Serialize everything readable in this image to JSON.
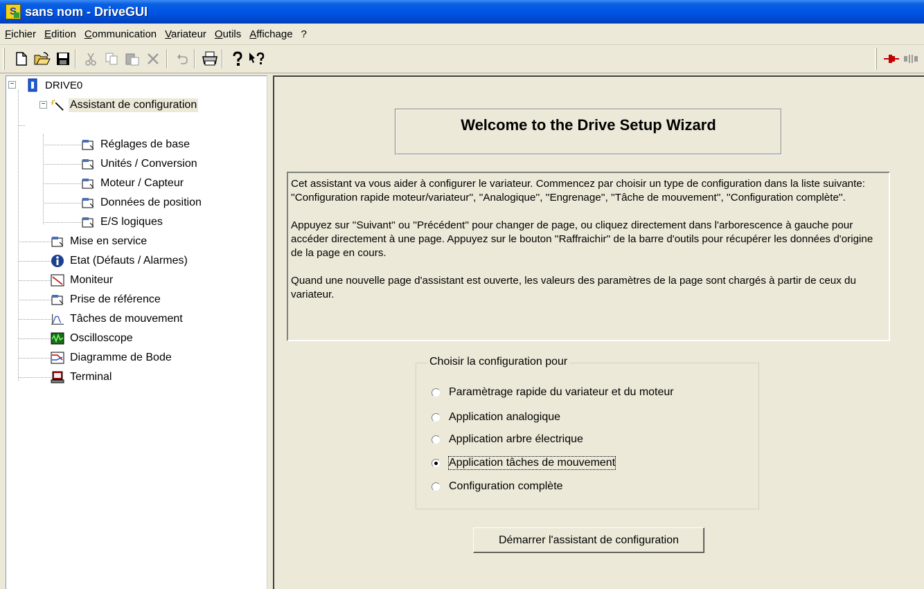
{
  "window": {
    "title": "sans nom - DriveGUI",
    "app_icon_letter": "S"
  },
  "menu": [
    "Fichier",
    "Edition",
    "Communication",
    "Variateur",
    "Outils",
    "Affichage",
    "?"
  ],
  "toolbar": {
    "icons": [
      "new-file-icon",
      "open-folder-icon",
      "save-icon",
      "cut-icon",
      "copy-icon",
      "paste-icon",
      "delete-icon",
      "undo-icon",
      "print-icon",
      "help-icon",
      "context-help-icon",
      "connect-icon",
      "disconnect-icon"
    ]
  },
  "tree": {
    "root": "DRIVE0",
    "wizard": "Assistant de configuration",
    "wizard_children": [
      "Réglages de base",
      "Unités / Conversion",
      "Moteur / Capteur",
      "Données de position",
      "E/S logiques"
    ],
    "items": [
      "Mise en service",
      "Etat (Défauts / Alarmes)",
      "Moniteur",
      "Prise de référence",
      "Tâches de mouvement",
      "Oscilloscope",
      "Diagramme de Bode",
      "Terminal"
    ]
  },
  "main": {
    "welcome_title": "Welcome to the Drive Setup Wizard",
    "intro": [
      "Cet assistant va vous aider à configurer le variateur. Commencez par choisir un type de configuration dans la liste suivante: ''Configuration rapide moteur/variateur'', ''Analogique'', ''Engrenage'', ''Tâche de mouvement'', ''Configuration complète''.",
      "Appuyez sur ''Suivant'' ou ''Précédent'' pour changer de page, ou cliquez directement dans l'arborescence à gauche pour accéder directement à une page. Appuyez sur le bouton ''Raffraichir'' de la barre d'outils pour récupérer les données d'origine de la page en cours.",
      "Quand une nouvelle page d'assistant est ouverte, les valeurs des paramètres de la page sont chargés à partir de ceux du variateur."
    ],
    "group_label": "Choisir la configuration pour",
    "options": [
      "Paramètrage rapide du variateur et du moteur",
      "Application analogique",
      "Application arbre électrique",
      "Application tâches de mouvement",
      "Configuration complète"
    ],
    "selected_option": "Application tâches de mouvement",
    "start_button": "Démarrer l'assistant de configuration"
  }
}
